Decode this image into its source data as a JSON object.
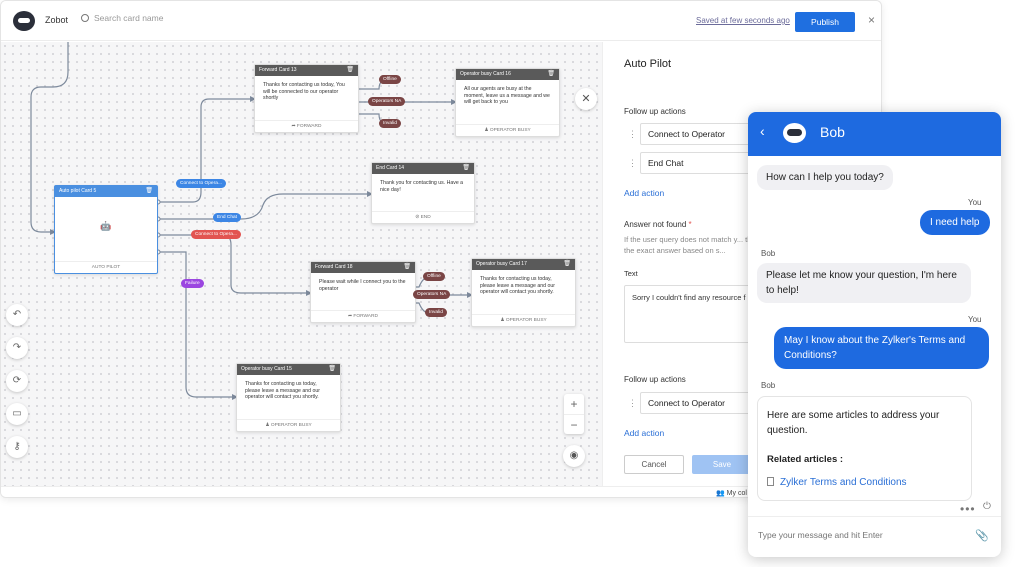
{
  "topbar": {
    "app_name": "Zobot",
    "search_placeholder": "Search card name",
    "saved_status": "Saved at few seconds ago",
    "publish_label": "Publish",
    "close_icon": "×"
  },
  "canvas": {
    "cards": {
      "autopilot": {
        "title": "Auto pilot Card 5",
        "footer": "AUTO PILOT"
      },
      "forward13": {
        "title": "Forward Card 13",
        "body": "Thanks for contacting us today, You will be connected to our operator shortly",
        "footer": "FORWARD"
      },
      "busy16": {
        "title": "Operator busy Card 16",
        "body": "All our agents are busy at the moment, leave us a message and we will get back to you",
        "footer": "OPERATOR BUSY"
      },
      "end14": {
        "title": "End Card 14",
        "body": "Thank you for contacting us. Have a nice day!",
        "footer": "END"
      },
      "forward18": {
        "title": "Forward Card 18",
        "body": "Please wait while I connect you to the operator",
        "footer": "FORWARD"
      },
      "busy17": {
        "title": "Operator busy Card 17",
        "body": "Thanks for contacting us today, please leave a message and our operator will contact you shortly.",
        "footer": "OPERATOR BUSY"
      },
      "busy15": {
        "title": "Operator busy Card 15",
        "body": "Thanks for contacting us today, please leave a message and our operator will contact you shortly.",
        "footer": "OPERATOR BUSY"
      }
    },
    "tags": {
      "connect_blue": "Connect to Opera...",
      "end_chat": "End Chat",
      "connect_red": "Connect to Opera...",
      "failure": "Failure",
      "offline1": "Offline",
      "opna1": "Operators NA",
      "invalid1": "Invalid",
      "offline2": "Offline",
      "opna2": "Operators NA",
      "invalid2": "Invalid"
    },
    "zoom_in": "+",
    "zoom_out": "−"
  },
  "panel": {
    "title": "Auto Pilot",
    "follow_up_label": "Follow up actions",
    "actions": [
      "Connect to Operator",
      "End Chat"
    ],
    "add_action": "Add action",
    "answer_not_found": "Answer not found",
    "required_mark": "*",
    "help": "If the user query does not match y... throw the exact answer based on s...",
    "text_label": "Text",
    "text_value": "Sorry I couldn't find any resource f",
    "follow_up_label2": "Follow up actions",
    "actions2": [
      "Connect to Operator"
    ],
    "add_action2": "Add action",
    "cancel": "Cancel",
    "save": "Save"
  },
  "bottombar": {
    "collection": "My col"
  },
  "chat": {
    "bot_name": "Bob",
    "msg1": "How can I help you today?",
    "you1": "You",
    "user1": "I need help",
    "bob1": "Bob",
    "msg2": "Please let me know your question, I'm here to help!",
    "you2": "You",
    "user2": "May I know about the Zylker's Terms and Conditions?",
    "bob2": "Bob",
    "msg3": "Here are some articles to address your question.",
    "related": "Related articles :",
    "article": "Zylker Terms and Conditions",
    "input_placeholder": "Type your message and hit Enter"
  }
}
